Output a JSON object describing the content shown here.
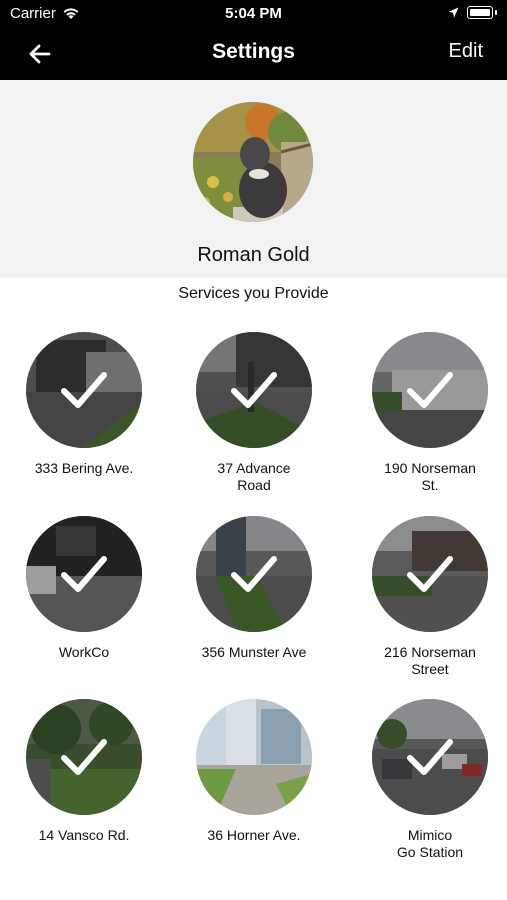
{
  "status_bar": {
    "carrier": "Carrier",
    "time": "5:04 PM"
  },
  "nav": {
    "title": "Settings",
    "edit_label": "Edit",
    "back_icon": "arrow-left-icon"
  },
  "profile": {
    "name": "Roman Gold"
  },
  "services_heading": "Services you Provide",
  "services": [
    {
      "label": "333 Bering Ave.",
      "selected": true
    },
    {
      "label": "37 Advance\nRoad",
      "selected": true
    },
    {
      "label": "190 Norseman\nSt.",
      "selected": true
    },
    {
      "label": "WorkCo",
      "selected": true
    },
    {
      "label": "356 Munster Ave",
      "selected": true
    },
    {
      "label": "216 Norseman\nStreet",
      "selected": true
    },
    {
      "label": "14 Vansco Rd.",
      "selected": true
    },
    {
      "label": "36 Horner Ave.",
      "selected": false
    },
    {
      "label": "Mimico\nGo Station",
      "selected": true
    }
  ]
}
